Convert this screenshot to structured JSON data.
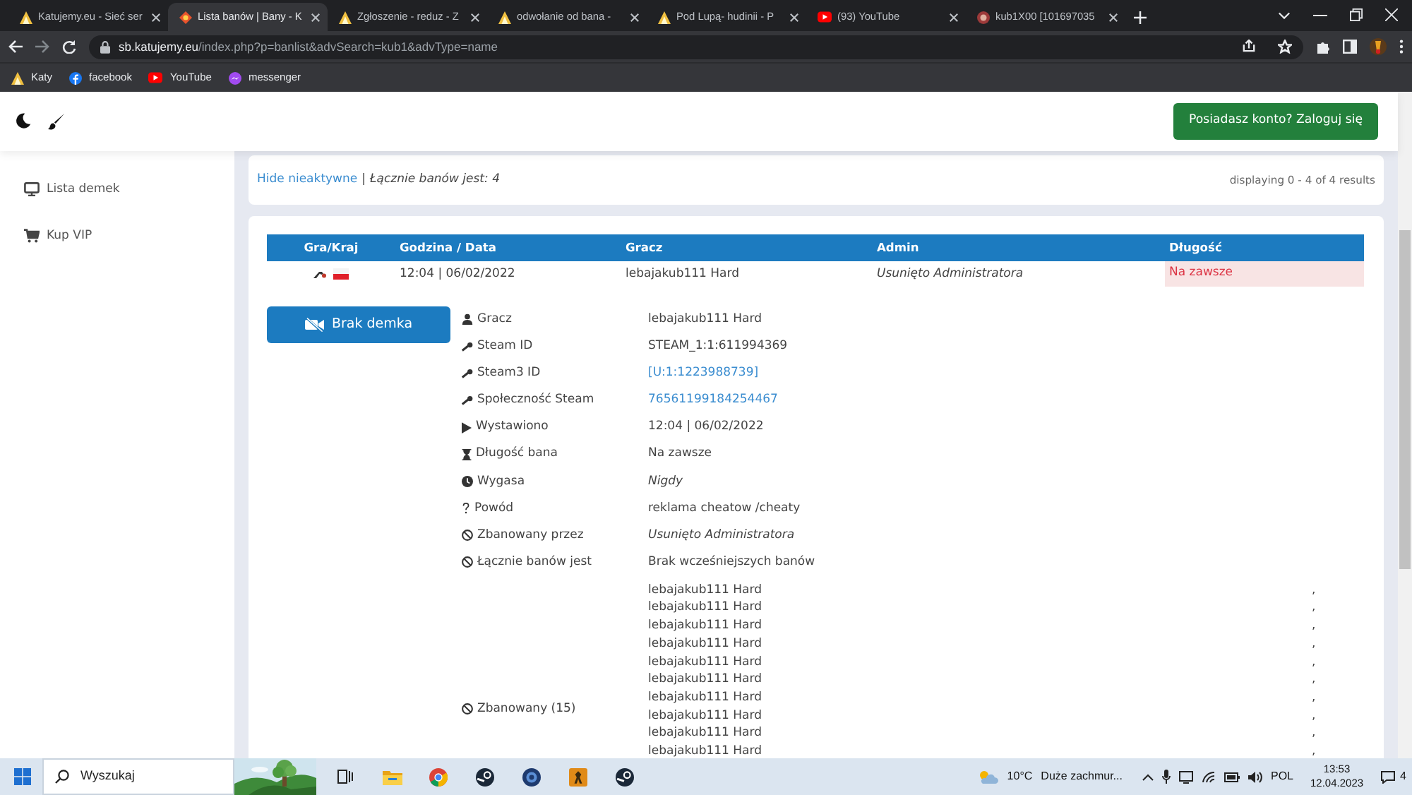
{
  "browser": {
    "tabs": [
      {
        "title": "Katujemy.eu - Sieć ser",
        "kind": "katujemy",
        "selected": false
      },
      {
        "title": "Lista banów | Bany - K",
        "kind": "sourcebans",
        "selected": true
      },
      {
        "title": "Zgłoszenie - reduz - Z",
        "kind": "katujemy",
        "selected": false
      },
      {
        "title": "odwołanie od bana -",
        "kind": "katujemy",
        "selected": false
      },
      {
        "title": "Pod Lupą- hudinii - P",
        "kind": "katujemy",
        "selected": false
      },
      {
        "title": "(93) YouTube",
        "kind": "youtube",
        "selected": false
      },
      {
        "title": "kub1X00 [101697035",
        "kind": "avatar",
        "selected": false
      }
    ],
    "address": {
      "host": "sb.katujemy.eu",
      "path": "/index.php?p=banlist&advSearch=kub1&advType=name"
    },
    "bookmarks": [
      {
        "label": "Katy",
        "kind": "katujemy"
      },
      {
        "label": "facebook",
        "kind": "facebook"
      },
      {
        "label": "YouTube",
        "kind": "youtube"
      },
      {
        "label": "messenger",
        "kind": "messenger"
      }
    ]
  },
  "navbar": {
    "login_button": "Posiadasz konto? Zaloguj się"
  },
  "sidebar": {
    "items": [
      {
        "label": "Lista demek",
        "kind": "monitor"
      },
      {
        "label": "Kup VIP",
        "kind": "cart"
      }
    ]
  },
  "filter_bar": {
    "link": "Hide nieaktywne",
    "separator": "|",
    "total": "Łącznie banów jest: 4",
    "pagination": "displaying 0 - 4 of 4 results"
  },
  "ban_table": {
    "columns": [
      "Gra/Kraj",
      "Godzina / Data",
      "Gracz",
      "Admin",
      "Długość"
    ],
    "row": {
      "time": "12:04 | 06/02/2022",
      "player": "lebajakub111 Hard",
      "admin": "Usunięto Administratora",
      "length": "Na zawsze"
    }
  },
  "details": {
    "demo_button": "Brak demka",
    "fields": [
      {
        "kind": "player",
        "label": "Gracz",
        "value": "lebajakub111 Hard"
      },
      {
        "kind": "steamid",
        "label": "Steam ID",
        "value": "STEAM_1:1:611994369"
      },
      {
        "kind": "steamlink",
        "label": "Steam3 ID",
        "value": "[U:1:1223988739]"
      },
      {
        "kind": "steamlink",
        "label": "Społeczność Steam",
        "value": "76561199184254467"
      },
      {
        "kind": "issued",
        "label": "Wystawiono",
        "value": "12:04 | 06/02/2022"
      },
      {
        "kind": "duration",
        "label": "Długość bana",
        "value": "Na zawsze"
      },
      {
        "kind": "expires",
        "label": "Wygasa",
        "value": "Nigdy"
      },
      {
        "kind": "reason",
        "label": "Powód",
        "value": "reklama cheatow /cheaty"
      },
      {
        "kind": "bannedby",
        "label": "Zbanowany przez",
        "value": "Usunięto Administratora"
      },
      {
        "kind": "history",
        "label": "Łącznie banów jest",
        "value": "Brak wcześniejszych banów"
      }
    ],
    "banned": {
      "label": "Zbanowany (15)",
      "entries": [
        {
          "name": "lebajakub111 Hard",
          "suffix": ","
        },
        {
          "name": "lebajakub111 Hard",
          "suffix": ","
        },
        {
          "name": "lebajakub111 Hard",
          "suffix": ","
        },
        {
          "name": "lebajakub111 Hard",
          "suffix": ","
        },
        {
          "name": "lebajakub111 Hard",
          "suffix": ","
        },
        {
          "name": "lebajakub111 Hard",
          "suffix": ","
        },
        {
          "name": "lebajakub111 Hard",
          "suffix": ","
        },
        {
          "name": "lebajakub111 Hard",
          "suffix": ","
        },
        {
          "name": "lebajakub111 Hard",
          "suffix": ","
        },
        {
          "name": "lebajakub111 Hard",
          "suffix": ","
        }
      ]
    }
  },
  "taskbar": {
    "search": "Wyszukaj",
    "apps": [
      {
        "kind": "taskview"
      },
      {
        "kind": "explorer"
      },
      {
        "kind": "chrome"
      },
      {
        "kind": "steam"
      },
      {
        "kind": "disc"
      },
      {
        "kind": "game"
      },
      {
        "kind": "steam"
      }
    ],
    "weather": {
      "temp": "10°C",
      "text": "Duże zachmur..."
    },
    "language": "POL",
    "time": "13:53",
    "date": "12.04.2023",
    "notifications": "4"
  }
}
